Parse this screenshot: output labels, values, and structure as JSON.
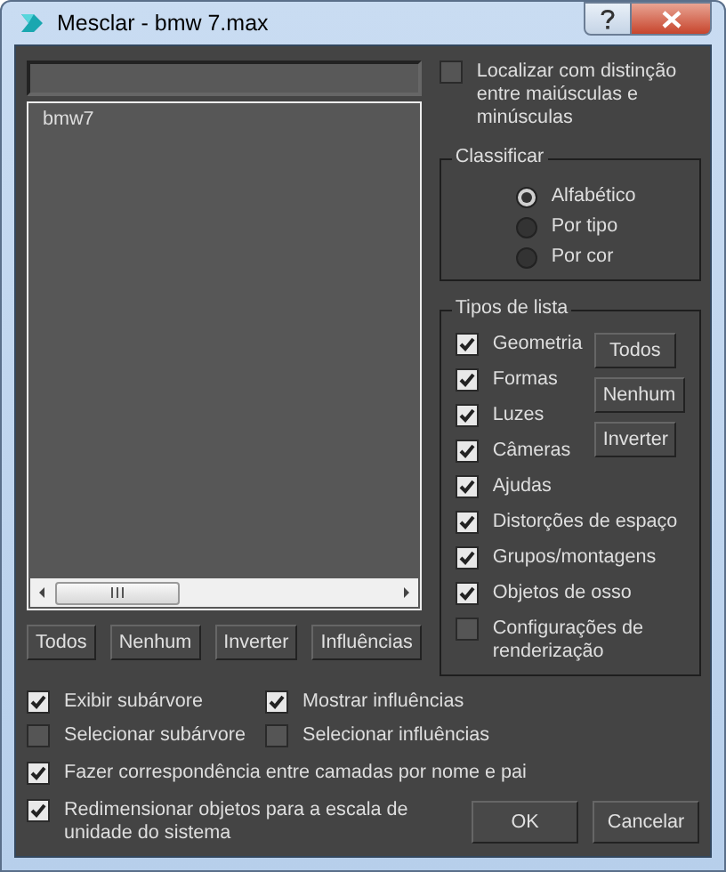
{
  "window": {
    "title": "Mesclar - bmw 7.max"
  },
  "object_list": {
    "items": [
      {
        "label": "bmw7",
        "selected": false
      }
    ]
  },
  "list_buttons": [
    "Todos",
    "Nenhum",
    "Inverter",
    "Influências"
  ],
  "case_sensitive": {
    "label": "Localizar com distinção entre maiúsculas e minúsculas",
    "checked": false
  },
  "sort": {
    "title": "Classificar",
    "options": [
      {
        "label": "Alfabético",
        "selected": true
      },
      {
        "label": "Por tipo",
        "selected": false
      },
      {
        "label": "Por cor",
        "selected": false
      }
    ]
  },
  "list_types": {
    "title": "Tipos de lista",
    "buttons": [
      "Todos",
      "Nenhum",
      "Inverter"
    ],
    "items": [
      {
        "label": "Geometria",
        "checked": true
      },
      {
        "label": "Formas",
        "checked": true
      },
      {
        "label": "Luzes",
        "checked": true
      },
      {
        "label": "Câmeras",
        "checked": true
      },
      {
        "label": "Ajudas",
        "checked": true
      },
      {
        "label": "Distorções de espaço",
        "checked": true
      },
      {
        "label": "Grupos/montagens",
        "checked": true
      },
      {
        "label": "Objetos de osso",
        "checked": true
      },
      {
        "label": "Configurações de renderização",
        "checked": false
      }
    ]
  },
  "options": [
    {
      "label": "Exibir subárvore",
      "checked": true
    },
    {
      "label": "Mostrar influências",
      "checked": true
    },
    {
      "label": "Selecionar subárvore",
      "checked": false
    },
    {
      "label": "Selecionar influências",
      "checked": false
    }
  ],
  "layer_match": {
    "label": "Fazer correspondência entre camadas por nome e pai",
    "checked": true
  },
  "rescale": {
    "label": "Redimensionar objetos para a escala de unidade do sistema",
    "checked": true
  },
  "dialog_buttons": [
    "OK",
    "Cancelar"
  ]
}
